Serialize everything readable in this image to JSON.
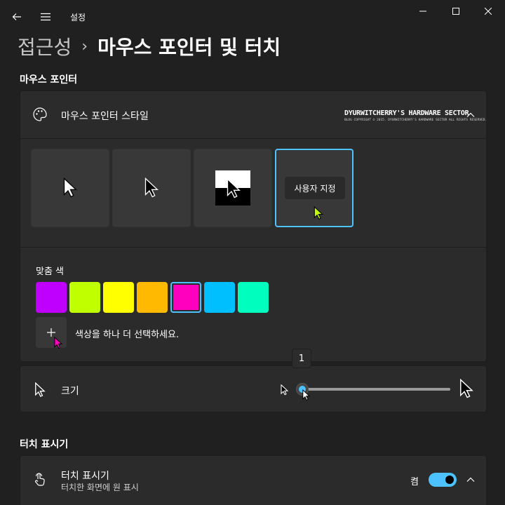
{
  "window": {
    "title": "설정",
    "controls": {
      "minimize": "minimize-icon",
      "maximize": "maximize-icon",
      "close": "close-icon"
    }
  },
  "breadcrumb": {
    "parent": "접근성",
    "separator": "›",
    "current": "마우스 포인터 및 터치"
  },
  "sections": {
    "mouse_pointer": "마우스 포인터",
    "touch_indicator": "터치 표시기"
  },
  "pointer_style": {
    "label": "마우스 포인터 스타일",
    "watermark_title": "DYURWITCHERRY'S HARDWARE SECTOR",
    "watermark_sub": "BLOG COPYRIGHT © 2015. DYURWITCHERRY'S HARDWARE SECTOR ALL RIGHTS RESERVED.",
    "tiles": [
      "white",
      "black",
      "inverted",
      "custom"
    ],
    "selected_tile": "custom",
    "custom_label": "사용자 지정",
    "custom_color": "#c0ff00"
  },
  "custom_colors": {
    "label": "맞춤 색",
    "swatches": [
      "#bf00ff",
      "#c0ff00",
      "#ffff00",
      "#ffb900",
      "#ff00bf",
      "#00bfff",
      "#00ffbf"
    ],
    "selected_index": 4,
    "add_label": "색상을 하나 더 선택하세요.",
    "add_icon": "plus-icon"
  },
  "size": {
    "label": "크기",
    "value": "1",
    "min": 1,
    "max": 15
  },
  "touch": {
    "label": "터치 표시기",
    "description": "터치한 화면에 원 표시",
    "state": "켬",
    "enabled": true
  },
  "colors": {
    "accent": "#4cc2ff",
    "background": "#202020",
    "card": "#2b2b2b"
  }
}
